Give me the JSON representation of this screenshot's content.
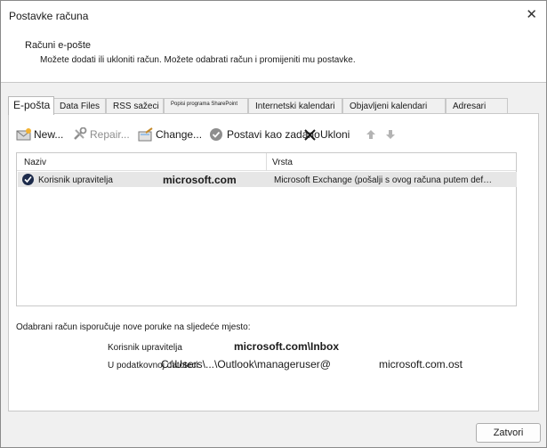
{
  "window": {
    "title": "Postavke računa",
    "close_glyph": "✕"
  },
  "header": {
    "title": "Računi e-pošte",
    "description": "Možete dodati ili ukloniti račun. Možete odabrati račun i promijeniti mu postavke."
  },
  "tabs": [
    {
      "label": "E-pošta",
      "active": true
    },
    {
      "label": "Data Files"
    },
    {
      "label": "RSS sažeci"
    },
    {
      "label": "Popisi programa SharePoint"
    },
    {
      "label": "Internetski kalendari"
    },
    {
      "label": "Objavljeni kalendari"
    },
    {
      "label": "Adresari"
    }
  ],
  "toolbar": {
    "new_label": "New...",
    "repair_label": "Repair...",
    "change_label": "Change...",
    "set_default_label": "Postavi kao zadano",
    "remove_label": "Ukloni"
  },
  "list": {
    "col_name": "Naziv",
    "col_type": "Vrsta",
    "rows": [
      {
        "name": "Korisnik upravitelja",
        "domain": "microsoft.com",
        "type": "Microsoft Exchange (pošalji s ovog računa putem def…"
      }
    ]
  },
  "delivery": {
    "info": "Odabrani račun isporučuje nove poruke na sljedeće mjesto:",
    "mailbox_label": "Korisnik upravitelja",
    "mailbox_value": "microsoft.com\\Inbox",
    "file_label": "U podatkovnoj datoteci",
    "file_path": "C:\\Users\\...\\Outlook\\manageruser@",
    "file_domain": "microsoft.com.ost"
  },
  "footer": {
    "close_label": "Zatvori"
  },
  "colors": {
    "accent_check": "#1c2a4a",
    "row_selected": "#e6e6e6",
    "disabled_text": "#8e8e8e"
  }
}
